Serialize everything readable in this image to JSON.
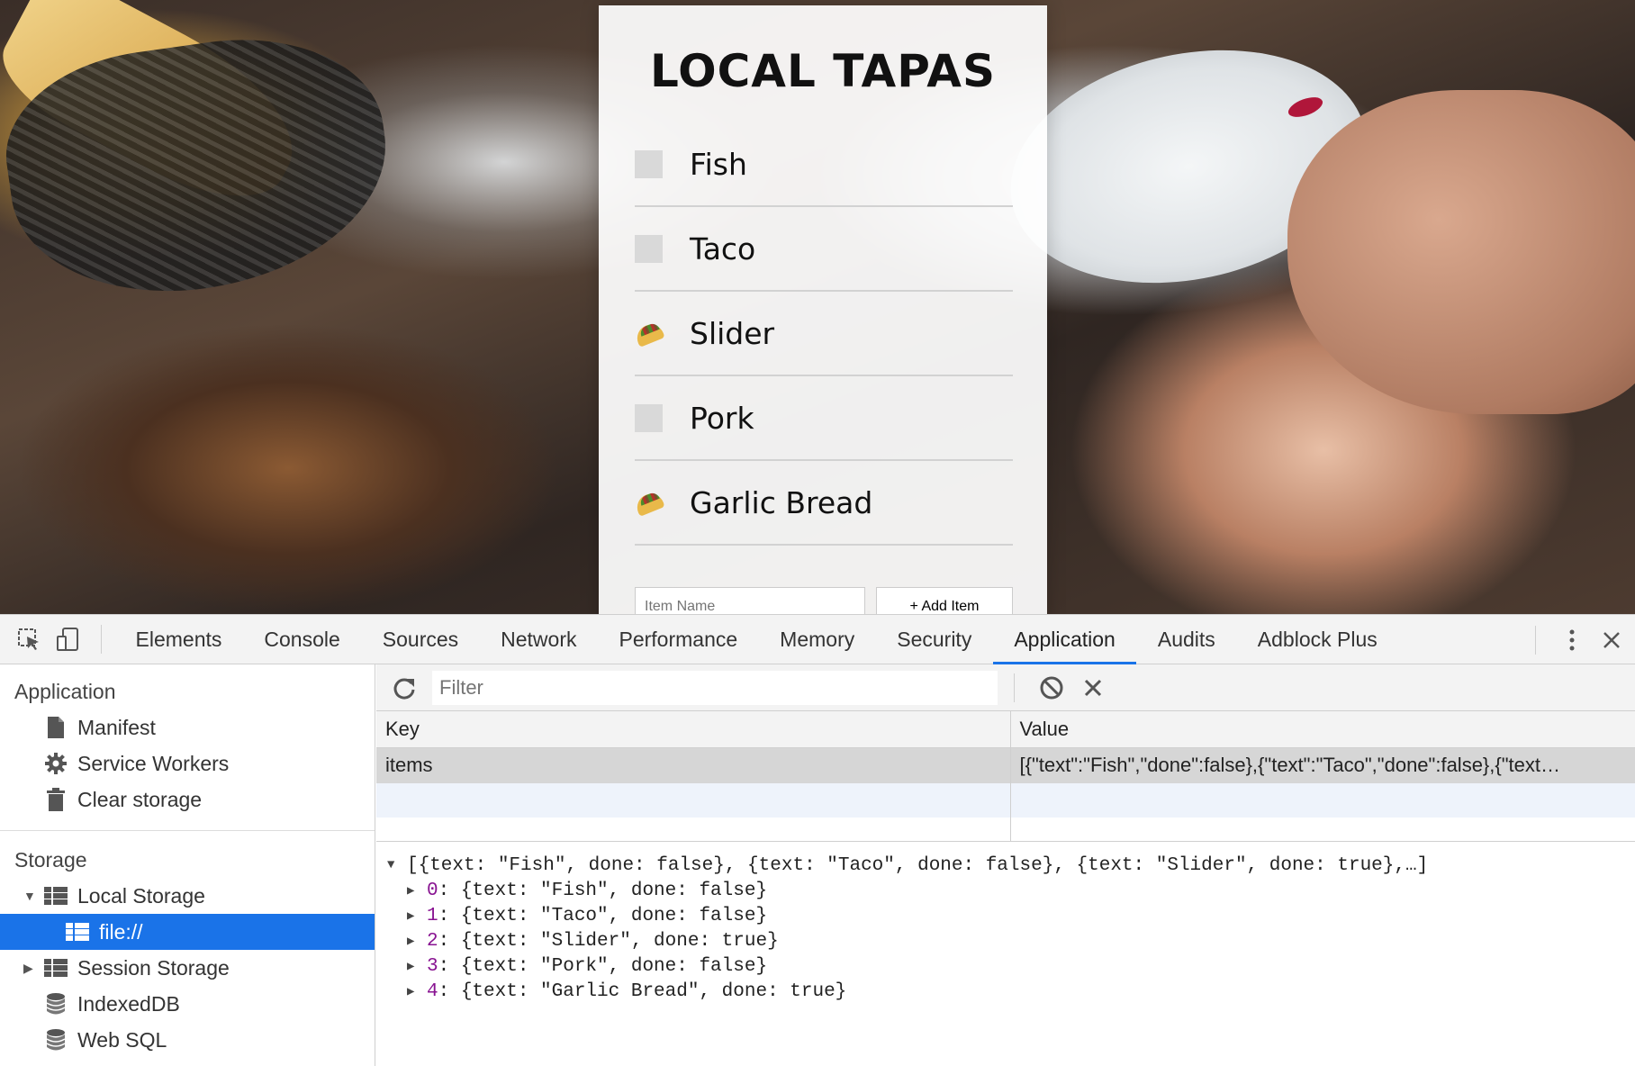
{
  "app": {
    "title": "LOCAL TAPAS",
    "items": [
      {
        "text": "Fish",
        "done": false
      },
      {
        "text": "Taco",
        "done": false
      },
      {
        "text": "Slider",
        "done": true
      },
      {
        "text": "Pork",
        "done": false
      },
      {
        "text": "Garlic Bread",
        "done": true
      }
    ],
    "add_form": {
      "input_placeholder": "Item Name",
      "button_label": "+ Add Item"
    }
  },
  "devtools": {
    "tabs": [
      "Elements",
      "Console",
      "Sources",
      "Network",
      "Performance",
      "Memory",
      "Security",
      "Application",
      "Audits",
      "Adblock Plus"
    ],
    "active_tab": "Application",
    "sidebar": {
      "application_header": "Application",
      "application_items": [
        "Manifest",
        "Service Workers",
        "Clear storage"
      ],
      "storage_header": "Storage",
      "local_storage": "Local Storage",
      "local_storage_child": "file://",
      "session_storage": "Session Storage",
      "indexeddb": "IndexedDB",
      "websql": "Web SQL"
    },
    "toolbar": {
      "filter_placeholder": "Filter"
    },
    "table": {
      "key_header": "Key",
      "value_header": "Value",
      "rows": [
        {
          "key": "items",
          "value": "[{\"text\":\"Fish\",\"done\":false},{\"text\":\"Taco\",\"done\":false},{\"text…"
        }
      ]
    },
    "preview": {
      "summary": "[{text: \"Fish\", done: false}, {text: \"Taco\", done: false}, {text: \"Slider\", done: true},…]",
      "children": [
        {
          "index": "0",
          "text": ": {text: \"Fish\", done: false}"
        },
        {
          "index": "1",
          "text": ": {text: \"Taco\", done: false}"
        },
        {
          "index": "2",
          "text": ": {text: \"Slider\", done: true}"
        },
        {
          "index": "3",
          "text": ": {text: \"Pork\", done: false}"
        },
        {
          "index": "4",
          "text": ": {text: \"Garlic Bread\", done: true}"
        }
      ]
    }
  },
  "colors": {
    "accent": "#1a73e8",
    "index_purple": "#881391"
  }
}
